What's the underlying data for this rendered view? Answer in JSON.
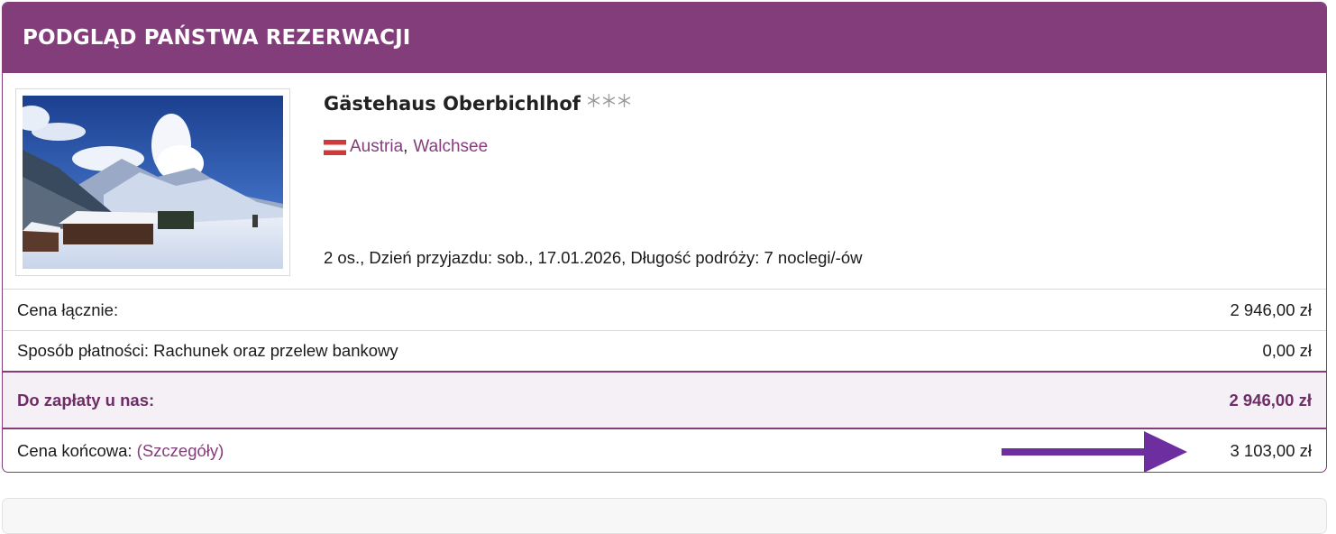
{
  "header": {
    "title": "PODGLĄD PAŃSTWA REZERWACJI"
  },
  "hotel": {
    "name": "Gästehaus Oberbichlhof",
    "star_count": 3,
    "star_icon": "snowflake-icon",
    "country": "Austria",
    "separator": ",",
    "city": "Walchsee",
    "flag": "austria-flag-icon",
    "details": "2 os., Dzień przyjazdu: sob., 17.01.2026, Długość podróży: 7 noclegi/-ów"
  },
  "summary": {
    "total_price_label": "Cena łącznie:",
    "total_price_value": "2 946,00 zł",
    "payment_label": "Sposób płatności: Rachunek oraz przelew bankowy",
    "payment_value": "0,00 zł",
    "to_pay_label": "Do zapłaty u nas:",
    "to_pay_value": "2 946,00 zł",
    "final_price_label": "Cena końcowa:",
    "final_price_link": "(Szczegóły)",
    "final_price_value": "3 103,00 zł"
  },
  "colors": {
    "brand_purple": "#843d7b",
    "arrow_purple": "#6d2fa0",
    "highlight_bg": "#f5f0f6"
  }
}
